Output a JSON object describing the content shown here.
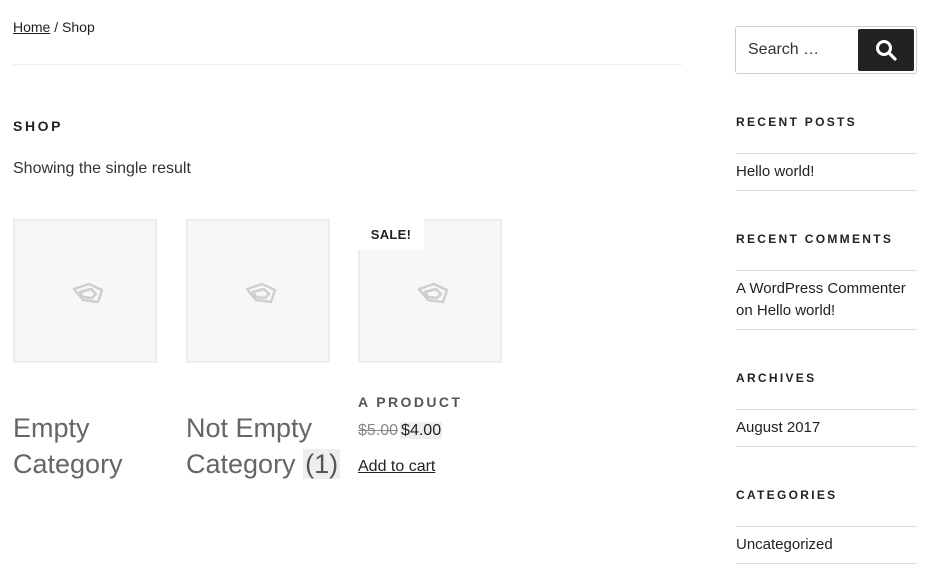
{
  "breadcrumb": {
    "home": "Home",
    "separator": " / ",
    "current": "Shop"
  },
  "shop": {
    "title": "SHOP",
    "result_count": "Showing the single result"
  },
  "products": {
    "sale_badge": "SALE!",
    "categories": [
      {
        "name": "Empty Category",
        "count": ""
      },
      {
        "name": "Not Empty Category",
        "count": "(1)"
      }
    ],
    "product": {
      "title": "A PRODUCT",
      "old_price": "$5.00",
      "new_price": "$4.00",
      "add_to_cart": "Add to cart"
    },
    "placeholder_icon": "image-placeholder-icon"
  },
  "sidebar": {
    "search": {
      "placeholder": "Search …",
      "button_icon": "search-icon"
    },
    "recent_posts": {
      "title": "RECENT POSTS",
      "items": [
        "Hello world!"
      ]
    },
    "recent_comments": {
      "title": "RECENT COMMENTS",
      "author": "A WordPress Commenter",
      "on": " on ",
      "post": "Hello world!"
    },
    "archives": {
      "title": "ARCHIVES",
      "items": [
        "August 2017"
      ]
    },
    "categories": {
      "title": "CATEGORIES",
      "items": [
        "Uncategorized"
      ]
    }
  },
  "colors": {
    "text": "#222222",
    "muted": "#666666",
    "search_button": "#222222",
    "placeholder_bg": "#f7f7f7"
  }
}
